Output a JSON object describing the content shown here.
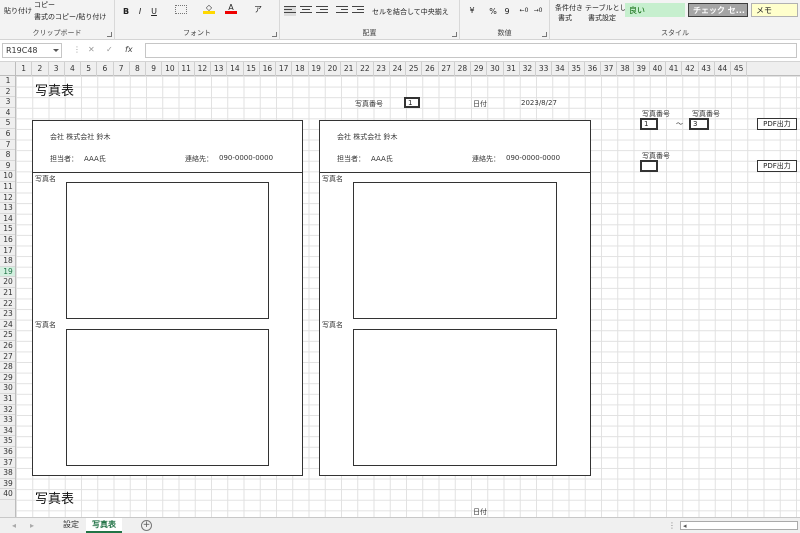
{
  "ribbon": {
    "clipboard": {
      "paste": "貼り付け",
      "copy": "コピー",
      "format_painter": "書式のコピー/貼り付け",
      "label": "クリップボード"
    },
    "font": {
      "bold": "B",
      "italic": "I",
      "underline": "U",
      "label": "フォント"
    },
    "alignment": {
      "merge_center": "セルを結合して中央揃え",
      "label": "配置"
    },
    "number": {
      "percent": "%",
      "comma": "9",
      "label": "数値"
    },
    "styles": {
      "conditional_format": "条件付き",
      "conditional_format2": "書式",
      "format_as_table": "テーブルとして",
      "format_as_table2": "書式設定",
      "good": "良い",
      "check_cell": "チェック セ...",
      "note": "メモ",
      "label": "スタイル"
    }
  },
  "formula_bar": {
    "name_box": "R19C48",
    "fx": "fx",
    "cancel": "✕",
    "enter": "✓",
    "value": ""
  },
  "columns": [
    "1",
    "2",
    "3",
    "4",
    "5",
    "6",
    "7",
    "8",
    "9",
    "10",
    "11",
    "12",
    "13",
    "14",
    "15",
    "16",
    "17",
    "18",
    "19",
    "20",
    "21",
    "22",
    "23",
    "24",
    "25",
    "26",
    "27",
    "28",
    "29",
    "30",
    "31",
    "32",
    "33",
    "34",
    "35",
    "36",
    "37",
    "38",
    "39",
    "40",
    "41",
    "42",
    "43",
    "44",
    "45"
  ],
  "rows": [
    "1",
    "2",
    "3",
    "4",
    "5",
    "6",
    "7",
    "8",
    "9",
    "10",
    "11",
    "12",
    "13",
    "14",
    "15",
    "16",
    "17",
    "18",
    "19",
    "20",
    "21",
    "22",
    "23",
    "24",
    "25",
    "26",
    "27",
    "28",
    "29",
    "30",
    "31",
    "32",
    "33",
    "34",
    "35",
    "36",
    "37",
    "38",
    "39",
    "40"
  ],
  "selected_row": "19",
  "sheet": {
    "title": "写真表",
    "title2": "写真表",
    "photo_number_label": "写真番号",
    "photo_number_value": "1",
    "date_label": "日付",
    "date_value": "2023/8/27",
    "date_label2": "日付",
    "left_panel": {
      "company": "会社 株式会社 鈴木",
      "person_label": "担当者：",
      "person": "AAA氏",
      "contact_label": "連絡先：",
      "contact": "090-0000-0000",
      "photo_name1": "写真名",
      "photo_name2": "写真名"
    },
    "right_panel": {
      "company": "会社 株式会社 鈴木",
      "person_label": "担当者：",
      "person": "AAA氏",
      "contact_label": "連絡先：",
      "contact": "090-0000-0000",
      "photo_name1": "写真名",
      "photo_name2": "写真名"
    },
    "side": {
      "range_label_from": "写真番号",
      "range_label_to": "写真番号",
      "range_from": "1",
      "range_sep": "～",
      "range_to": "3",
      "pdf_button": "PDF出力",
      "single_label": "写真番号",
      "single_value": "",
      "pdf_button2": "PDF出力"
    }
  },
  "tabs": [
    {
      "label": "設定",
      "active": false
    },
    {
      "label": "写真表",
      "active": true
    }
  ],
  "add_sheet": "+"
}
